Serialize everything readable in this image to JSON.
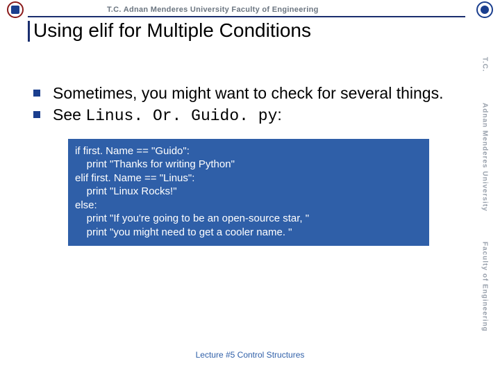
{
  "header": {
    "text": "T.C.    Adnan Menderes University    Faculty of Engineering"
  },
  "title": "Using elif for Multiple Conditions",
  "bullets": [
    {
      "text": "Sometimes, you might want to check for several things."
    },
    {
      "prefix": "See ",
      "code": "Linus. Or. Guido. py",
      "suffix": ":"
    }
  ],
  "code": [
    "if first. Name == \"Guido\":",
    "    print \"Thanks for writing Python\"",
    "elif first. Name == \"Linus\":",
    "    print \"Linux Rocks!\"",
    "else:",
    "    print \"If you're going to be an open-source star, \"",
    "    print \"you might need to get a cooler name. \""
  ],
  "footer": "Lecture #5 Control Structures",
  "side": {
    "a": "T.C.",
    "b": "Adnan Menderes University",
    "c": "Faculty of Engineering"
  }
}
